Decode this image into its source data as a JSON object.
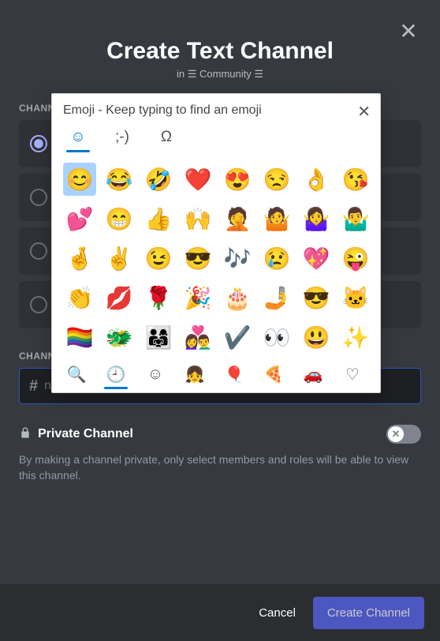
{
  "modal": {
    "title": "Create Text Channel",
    "subtitle": "in ☰ Community ☰"
  },
  "channelTypeLabel": "CHANNEL TYPE",
  "types": [
    {
      "selected": true
    },
    {
      "selected": false
    },
    {
      "selected": false
    },
    {
      "selected": false
    }
  ],
  "nameLabel": "CHANNEL NAME",
  "nameInput": {
    "hash": "#",
    "placeholder": "new-channel",
    "value": ""
  },
  "private": {
    "label": "Private Channel",
    "on": false,
    "desc": "By making a channel private, only select members and roles will be able to view this channel."
  },
  "buttons": {
    "cancel": "Cancel",
    "create": "Create Channel"
  },
  "emojiPicker": {
    "title": "Emoji - Keep typing to find an emoji",
    "tabs": [
      {
        "name": "smiley-tab",
        "glyph": "☺",
        "active": true
      },
      {
        "name": "kaomoji-tab",
        "glyph": ";-)",
        "active": false
      },
      {
        "name": "symbols-tab",
        "glyph": "Ω",
        "active": false
      }
    ],
    "emojis": [
      [
        "😊",
        "😂",
        "🤣",
        "❤️",
        "😍",
        "😒",
        "👌",
        "😘"
      ],
      [
        "💕",
        "😁",
        "👍",
        "🙌",
        "🤦",
        "🤷",
        "🤷‍♀️",
        "🤷‍♂️"
      ],
      [
        "🤞",
        "✌️",
        "😉",
        "😎",
        "🎶",
        "😢",
        "💖",
        "😜"
      ],
      [
        "👏",
        "💋",
        "🌹",
        "🎉",
        "🎂",
        "🤳",
        "😎",
        "🐱"
      ],
      [
        "🏳️‍🌈",
        "🐲",
        "👨‍👩‍👧",
        "👩‍❤️‍👨",
        "✔️",
        "👀",
        "😃",
        "✨"
      ]
    ],
    "selected": [
      0,
      0
    ],
    "categories": [
      {
        "name": "search",
        "glyph": "🔍",
        "active": false,
        "mono": true
      },
      {
        "name": "recent",
        "glyph": "🕘",
        "active": true,
        "mono": true
      },
      {
        "name": "smileys",
        "glyph": "☺",
        "active": false,
        "mono": true
      },
      {
        "name": "people",
        "glyph": "👧",
        "active": false,
        "mono": true
      },
      {
        "name": "activities",
        "glyph": "🎈",
        "active": false,
        "mono": true
      },
      {
        "name": "food",
        "glyph": "🍕",
        "active": false,
        "mono": true
      },
      {
        "name": "travel",
        "glyph": "🚗",
        "active": false,
        "mono": true
      },
      {
        "name": "symbols-cat",
        "glyph": "♡",
        "active": false,
        "mono": true
      }
    ]
  }
}
